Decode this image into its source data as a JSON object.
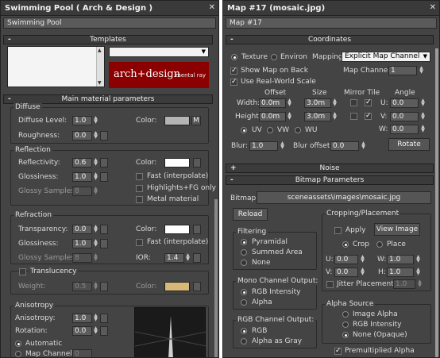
{
  "left": {
    "title": "Swimming Pool  ( Arch & Design )",
    "material_name": "Swimming Pool",
    "templates": {
      "header": "Templates",
      "logo_text": "arch+design",
      "logo_brand": "mental ray",
      "logo_color": "#8b0000",
      "dropdown_value": ""
    },
    "main_params_header": "Main material parameters",
    "diffuse": {
      "title": "Diffuse",
      "level_label": "Diffuse Level:",
      "level_value": "1.0",
      "roughness_label": "Roughness:",
      "roughness_value": "0.0",
      "color_label": "Color:",
      "color_hex": "#b4b4b4",
      "map_button": "M"
    },
    "reflection": {
      "title": "Reflection",
      "reflectivity_label": "Reflectivity:",
      "reflectivity_value": "0.6",
      "glossiness_label": "Glossiness:",
      "glossiness_value": "1.0",
      "samples_label": "Glossy Samples:",
      "samples_value": "8",
      "color_label": "Color:",
      "color_hex": "#ffffff",
      "fast_label": "Fast (interpolate)",
      "highlights_label": "Highlights+FG only",
      "metal_label": "Metal material"
    },
    "refraction": {
      "title": "Refraction",
      "transparency_label": "Transparency:",
      "transparency_value": "0.0",
      "glossiness_label": "Glossiness:",
      "glossiness_value": "1.0",
      "samples_label": "Glossy Samples:",
      "samples_value": "8",
      "color_label": "Color:",
      "color_hex": "#ffffff",
      "fast_label": "Fast (interpolate)",
      "ior_label": "IOR:",
      "ior_value": "1.4"
    },
    "translucency": {
      "title": "Translucency",
      "weight_label": "Weight:",
      "weight_value": "0.5",
      "color_label": "Color:",
      "color_hex": "#d8b878"
    },
    "anisotropy": {
      "title": "Anisotropy",
      "anisotropy_label": "Anisotropy:",
      "anisotropy_value": "1.0",
      "rotation_label": "Rotation:",
      "rotation_value": "0.0",
      "automatic_label": "Automatic",
      "map_channel_label": "Map Channel:",
      "map_channel_value": "0"
    }
  },
  "right": {
    "title": "Map #17 (mosaic.jpg)",
    "map_name": "Map #17",
    "coordinates": {
      "header": "Coordinates",
      "texture_label": "Texture",
      "environ_label": "Environ",
      "mapping_label": "Mapping:",
      "mapping_value": "Explicit Map Channel",
      "show_map_label": "Show Map on Back",
      "map_channel_label": "Map Channel:",
      "map_channel_value": "1",
      "real_world_label": "Use Real-World Scale",
      "offset_header": "Offset",
      "size_header": "Size",
      "mirror_tile_header": "Mirror Tile",
      "angle_header": "Angle",
      "width_label": "Width:",
      "width_offset": "0.0m",
      "width_size": "3.0m",
      "height_label": "Height:",
      "height_offset": "0.0m",
      "height_size": "3.0m",
      "u_label": "U:",
      "u_value": "0.0",
      "v_label": "V:",
      "v_value": "0.0",
      "w_label": "W:",
      "w_value": "0.0",
      "uv_label": "UV",
      "vw_label": "VW",
      "wu_label": "WU",
      "blur_label": "Blur:",
      "blur_value": "1.0",
      "blur_offset_label": "Blur offset:",
      "blur_offset_value": "0.0",
      "rotate_button": "Rotate"
    },
    "noise_header": "Noise",
    "bitmap": {
      "header": "Bitmap Parameters",
      "bitmap_label": "Bitmap:",
      "bitmap_path": "sceneassets\\images\\mosaic.jpg",
      "reload_button": "Reload",
      "filtering_title": "Filtering",
      "pyramidal_label": "Pyramidal",
      "summed_area_label": "Summed Area",
      "none_label": "None",
      "mono_title": "Mono Channel Output:",
      "rgb_intensity_label": "RGB Intensity",
      "alpha_label": "Alpha",
      "rgb_out_title": "RGB Channel Output:",
      "rgb_label": "RGB",
      "alpha_gray_label": "Alpha as Gray",
      "cropping_title": "Cropping/Placement",
      "apply_label": "Apply",
      "view_image_button": "View Image",
      "crop_label": "Crop",
      "place_label": "Place",
      "u_label": "U:",
      "u_value": "0.0",
      "v_label": "V:",
      "v_value": "0.0",
      "w_label": "W:",
      "w_value": "1.0",
      "h_label": "H:",
      "h_value": "1.0",
      "jitter_label": "Jitter Placement:",
      "jitter_value": "1.0",
      "alpha_source_title": "Alpha Source",
      "image_alpha_label": "Image Alpha",
      "rgb_intensity2_label": "RGB Intensity",
      "none_opaque_label": "None (Opaque)",
      "premultiplied_label": "Premultiplied Alpha"
    }
  }
}
